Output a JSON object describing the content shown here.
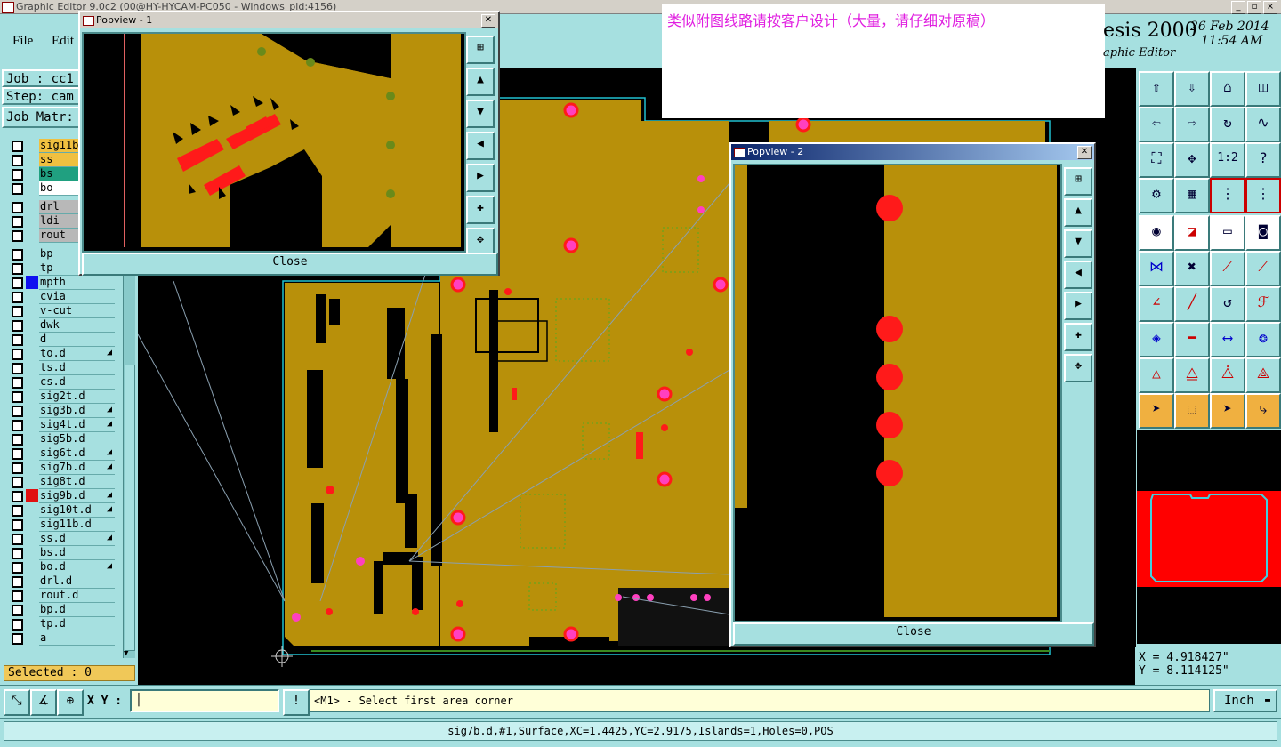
{
  "window": {
    "title": "Graphic Editor 9.0c2 (00@HY-HYCAM-PC050 - Windows_pid:4156)"
  },
  "menu": {
    "file": "File",
    "edit": "Edit"
  },
  "job": {
    "label": "Job : cc1",
    "step": "Step: cam",
    "matrix": "Job Matr:"
  },
  "layers": [
    {
      "name": "sig11b",
      "color": "#f0c040"
    },
    {
      "name": "ss",
      "color": "#f0c040"
    },
    {
      "name": "bs",
      "color": "#20a080"
    },
    {
      "name": "bo",
      "color": "#ffffff"
    },
    {
      "name": "drl",
      "color": "#b8b8b8"
    },
    {
      "name": "ldi",
      "color": "#b8b8b8"
    },
    {
      "name": "rout",
      "color": "#b8b8b8"
    },
    {
      "name": "bp",
      "color": ""
    },
    {
      "name": "tp",
      "color": ""
    },
    {
      "name": "mpth",
      "color": "",
      "mark": "#1010f0"
    },
    {
      "name": "cvia",
      "color": ""
    },
    {
      "name": "v-cut",
      "color": ""
    },
    {
      "name": "dwk",
      "color": ""
    },
    {
      "name": "d",
      "color": ""
    },
    {
      "name": "to.d",
      "color": "",
      "flag": true
    },
    {
      "name": "ts.d",
      "color": ""
    },
    {
      "name": "cs.d",
      "color": ""
    },
    {
      "name": "sig2t.d",
      "color": ""
    },
    {
      "name": "sig3b.d",
      "color": "",
      "flag": true
    },
    {
      "name": "sig4t.d",
      "color": "",
      "flag": true
    },
    {
      "name": "sig5b.d",
      "color": ""
    },
    {
      "name": "sig6t.d",
      "color": "",
      "flag": true
    },
    {
      "name": "sig7b.d",
      "color": "",
      "flag": true
    },
    {
      "name": "sig8t.d",
      "color": ""
    },
    {
      "name": "sig9b.d",
      "color": "",
      "mark": "#e01010",
      "flag": true
    },
    {
      "name": "sig10t.d",
      "color": "",
      "flag": true
    },
    {
      "name": "sig11b.d",
      "color": ""
    },
    {
      "name": "ss.d",
      "color": "",
      "flag": true
    },
    {
      "name": "bs.d",
      "color": ""
    },
    {
      "name": "bo.d",
      "color": "",
      "flag": true
    },
    {
      "name": "drl.d",
      "color": ""
    },
    {
      "name": "rout.d",
      "color": ""
    },
    {
      "name": "bp.d",
      "color": ""
    },
    {
      "name": "tp.d",
      "color": ""
    },
    {
      "name": "a",
      "color": ""
    }
  ],
  "selected": "Selected : 0",
  "popview1": {
    "title": "Popview - 1",
    "close": "Close"
  },
  "popview2": {
    "title": "Popview - 2",
    "close": "Close"
  },
  "note": "类似附图线路请按客户设计（大量，请仔细对原稿）",
  "brand": {
    "name": "esis 2000",
    "subtitle": "aphic Editor",
    "date": "26 Feb 2014",
    "time": "11:54 AM"
  },
  "coords": {
    "x": "X = 4.918427\"",
    "y": "Y = 8.114125\""
  },
  "bottom": {
    "xy_label": "X Y :",
    "prompt": "<M1> - Select first area corner",
    "units": "Inch",
    "units_arrow": "▬"
  },
  "status": "sig7b.d,#1,Surface,XC=1.4425,YC=2.9175,Islands=1,Holes=0,POS",
  "colors": {
    "board": "#b8900a",
    "pad": "#ff1a1a",
    "via": "#ff40c0",
    "panel": "#a6e0e0"
  }
}
